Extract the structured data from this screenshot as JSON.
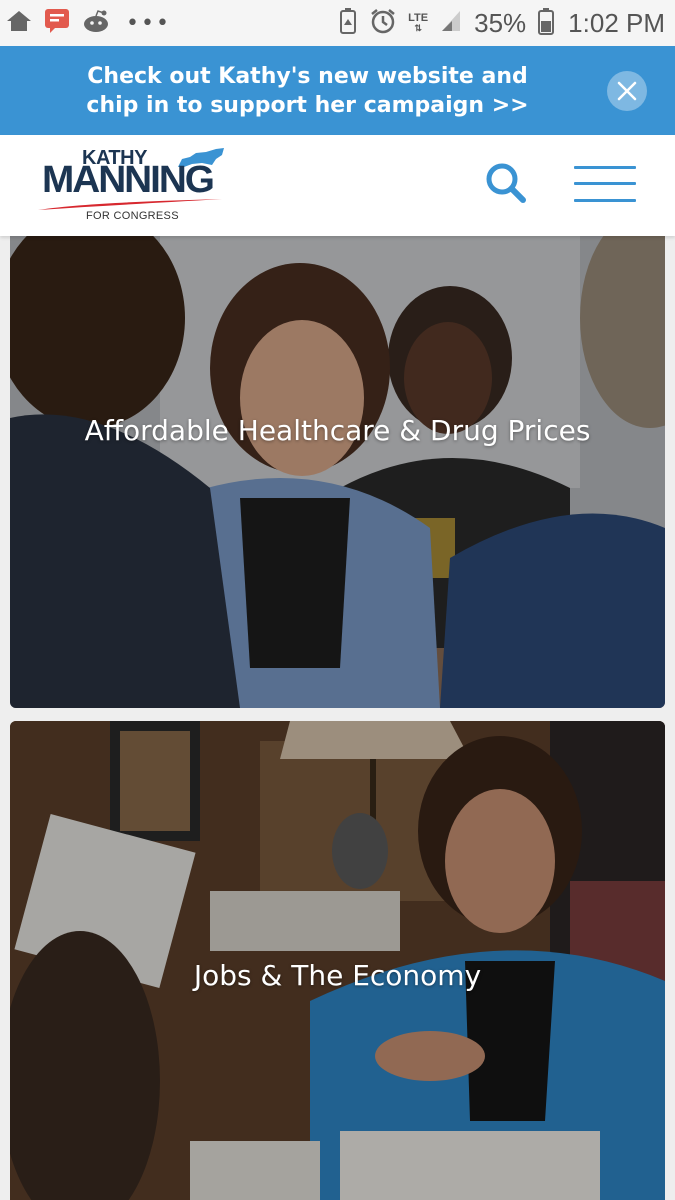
{
  "status_bar": {
    "battery": "35%",
    "time": "1:02 PM",
    "network": "LTE",
    "overflow": "•••"
  },
  "promo": {
    "text": "Check out Kathy's new website and chip in to support her campaign >>",
    "close_icon": "close-icon"
  },
  "header": {
    "logo": {
      "first": "KATHY",
      "last": "MANNING",
      "tagline": "FOR CONGRESS"
    },
    "search_icon": "search-icon",
    "menu_icon": "hamburger-menu-icon"
  },
  "cards": [
    {
      "title": "Affordable Healthcare & Drug Prices"
    },
    {
      "title": "Jobs & The Economy"
    }
  ],
  "colors": {
    "accent": "#3a93d3",
    "logo_navy": "#1c3552",
    "logo_red": "#d7282f"
  }
}
